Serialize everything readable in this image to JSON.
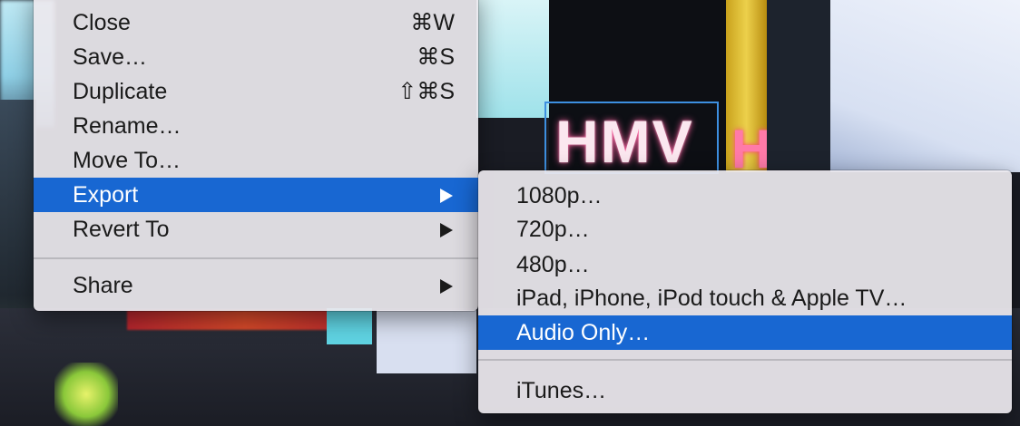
{
  "background_text": {
    "hmv_sign": "HMV",
    "pillar_sign": "H"
  },
  "file_menu": {
    "items": [
      {
        "label": "Close",
        "shortcut": "⌘W"
      },
      {
        "label": "Save…",
        "shortcut": "⌘S"
      },
      {
        "label": "Duplicate",
        "shortcut": "⇧⌘S"
      },
      {
        "label": "Rename…",
        "shortcut": ""
      },
      {
        "label": "Move To…",
        "shortcut": ""
      },
      {
        "label": "Export",
        "submenu": true,
        "selected": true
      },
      {
        "label": "Revert To",
        "submenu": true
      },
      {
        "label": "Share",
        "submenu": true
      }
    ]
  },
  "export_submenu": {
    "items": [
      {
        "label": "1080p…"
      },
      {
        "label": "720p…"
      },
      {
        "label": "480p…"
      },
      {
        "label": "iPad, iPhone, iPod touch & Apple TV…"
      },
      {
        "label": "Audio Only…",
        "selected": true
      },
      {
        "label": "iTunes…"
      }
    ]
  },
  "colors": {
    "highlight": "#1867d2",
    "menu_bg": "#ece8ee",
    "text": "#1a1a1a"
  },
  "icons": {
    "submenu_arrow": "triangle-right-icon"
  }
}
